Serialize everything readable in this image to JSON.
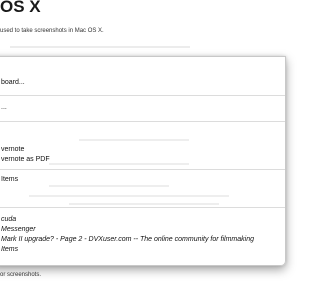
{
  "page": {
    "heading": "OS X",
    "intro": "used to take screenshots in Mac OS X.",
    "footer": "or screenshots."
  },
  "menu": {
    "items": [
      {
        "label": "board..."
      },
      {
        "label": "..."
      },
      {
        "label": "vernote"
      },
      {
        "label": "vernote as PDF"
      },
      {
        "label": "Items"
      },
      {
        "label": "cuda"
      },
      {
        "label": "Messenger"
      },
      {
        "label": "Mark II upgrade? - Page 2 - DVXuser.com -- The online community for filmmaking"
      },
      {
        "label": "Items"
      }
    ]
  }
}
